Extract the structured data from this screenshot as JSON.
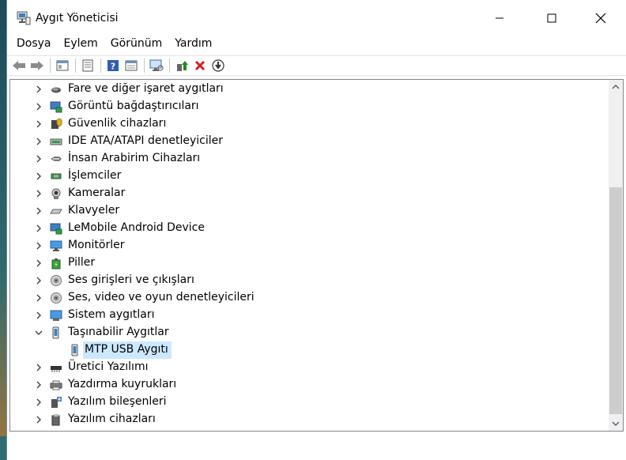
{
  "window": {
    "title": "Aygıt Yöneticisi"
  },
  "menu": [
    "Dosya",
    "Eylem",
    "Görünüm",
    "Yardım"
  ],
  "toolbar": {
    "icons": [
      "back-icon",
      "forward-icon",
      "properties-icon",
      "show-hidden-icon",
      "help-icon",
      "view-icon",
      "monitor-icon",
      "update-driver-icon",
      "uninstall-icon",
      "download-icon"
    ],
    "uninstall_color": "#d42020",
    "update_color": "#1e8e1e"
  },
  "tree": {
    "items": [
      {
        "label": "Fare ve diğer işaret aygıtları",
        "icon": "mouse-icon",
        "expanded": false
      },
      {
        "label": "Görüntü bağdaştırıcıları",
        "icon": "display-adapter-icon",
        "expanded": false
      },
      {
        "label": "Güvenlik cihazları",
        "icon": "security-device-icon",
        "expanded": false
      },
      {
        "label": "IDE ATA/ATAPI denetleyiciler",
        "icon": "ide-controller-icon",
        "expanded": false
      },
      {
        "label": "İnsan Arabirim Cihazları",
        "icon": "hid-icon",
        "expanded": false
      },
      {
        "label": "İşlemciler",
        "icon": "processor-icon",
        "expanded": false
      },
      {
        "label": "Kameralar",
        "icon": "camera-icon",
        "expanded": false
      },
      {
        "label": "Klavyeler",
        "icon": "keyboard-icon",
        "expanded": false
      },
      {
        "label": "LeMobile Android Device",
        "icon": "android-device-icon",
        "expanded": false
      },
      {
        "label": "Monitörler",
        "icon": "monitor-icon",
        "expanded": false
      },
      {
        "label": "Piller",
        "icon": "battery-icon",
        "expanded": false
      },
      {
        "label": "Ses girişleri ve çıkışları",
        "icon": "audio-io-icon",
        "expanded": false
      },
      {
        "label": "Ses, video ve oyun denetleyicileri",
        "icon": "sound-controller-icon",
        "expanded": false
      },
      {
        "label": "Sistem aygıtları",
        "icon": "system-device-icon",
        "expanded": false
      },
      {
        "label": "Taşınabilir Aygıtlar",
        "icon": "portable-device-icon",
        "expanded": true
      },
      {
        "label": "MTP USB Aygıtı",
        "icon": "phone-icon",
        "child": true,
        "selected": true
      },
      {
        "label": "Üretici Yazılımı",
        "icon": "firmware-icon",
        "expanded": false
      },
      {
        "label": "Yazdırma kuyrukları",
        "icon": "print-queue-icon",
        "expanded": false
      },
      {
        "label": "Yazılım bileşenleri",
        "icon": "software-component-icon",
        "expanded": false
      },
      {
        "label": "Yazılım cihazları",
        "icon": "software-device-icon",
        "expanded": false
      }
    ]
  },
  "colors": {
    "selection": "#cce8ff",
    "accent": "#0078d7"
  }
}
